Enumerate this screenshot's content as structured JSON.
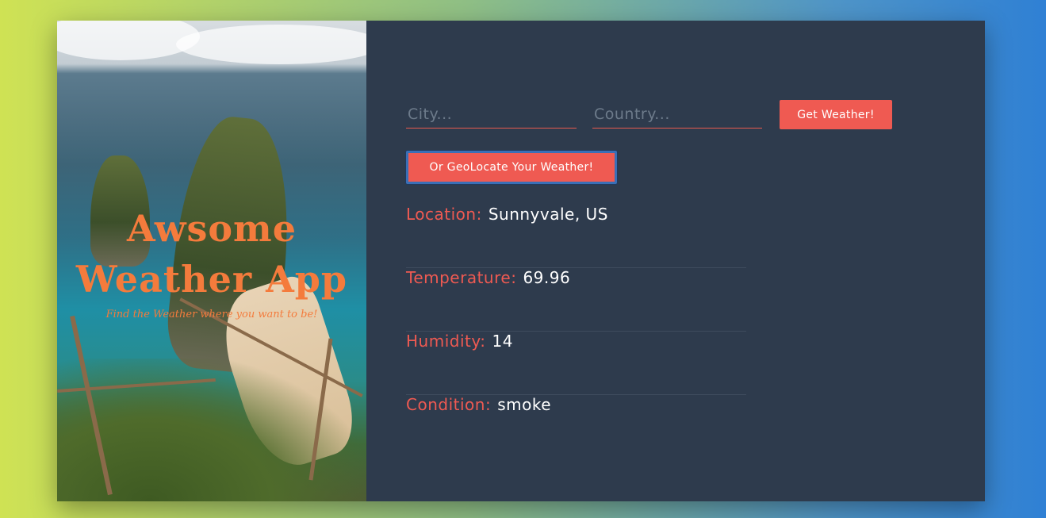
{
  "hero": {
    "title_line1": "Awsome",
    "title_line2": "Weather App",
    "subtitle": "Find the Weather where you want to be!"
  },
  "form": {
    "city_placeholder": "City...",
    "city_value": "",
    "country_placeholder": "Country...",
    "country_value": "",
    "get_weather_label": "Get Weather!",
    "geolocate_label": "Or GeoLocate Your Weather!"
  },
  "results": {
    "location_label": "Location:",
    "location_value": "Sunnyvale, US",
    "temperature_label": "Temperature:",
    "temperature_value": "69.96",
    "humidity_label": "Humidity:",
    "humidity_value": "14",
    "condition_label": "Condition:",
    "condition_value": "smoke"
  },
  "colors": {
    "accent": "#ef5a52",
    "panel_bg": "#2e3b4d",
    "hero_title": "#f47b3c"
  }
}
